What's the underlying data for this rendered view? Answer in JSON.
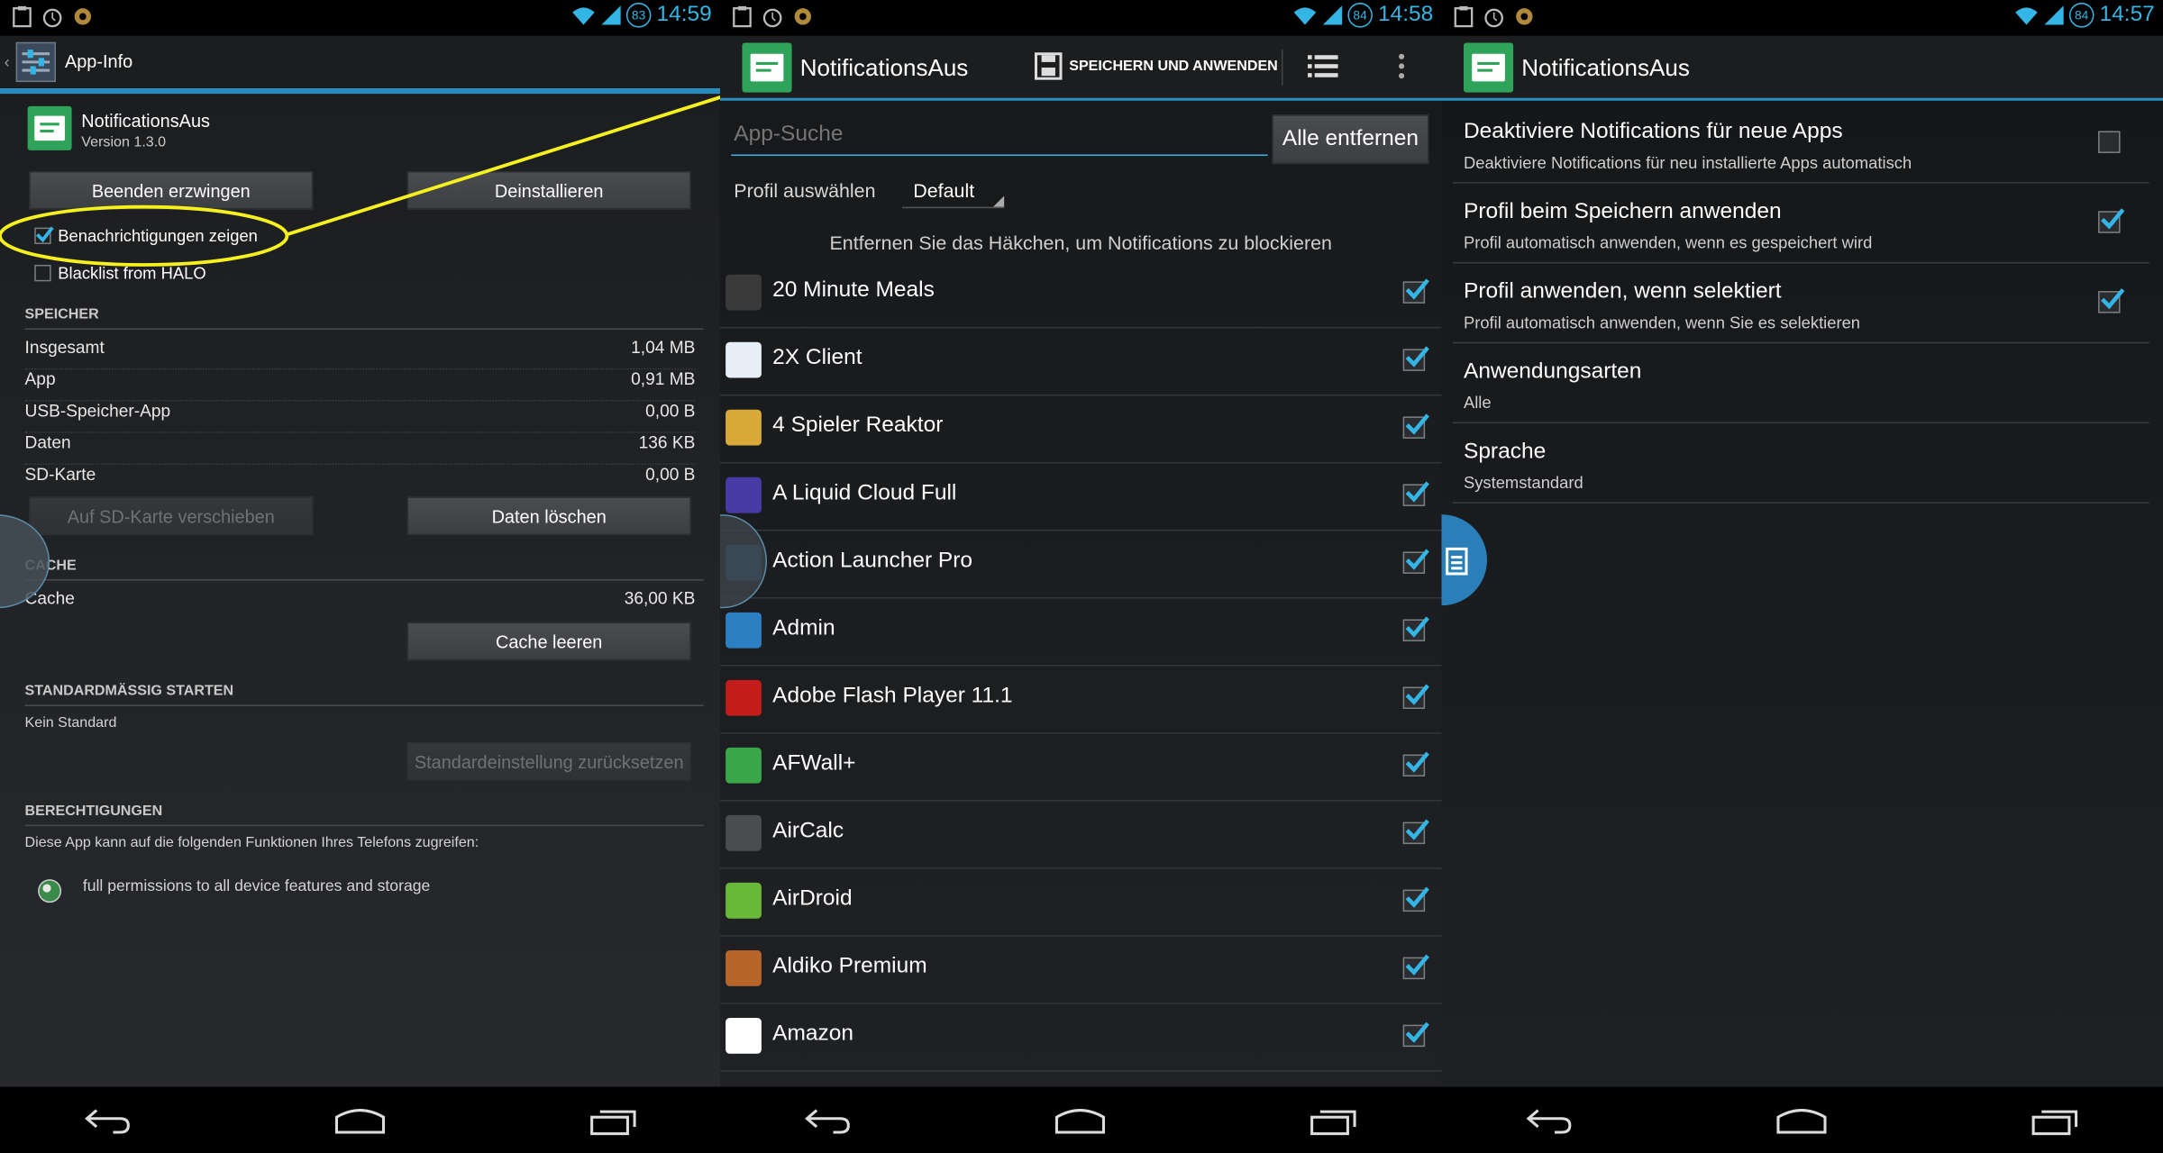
{
  "status": {
    "p1_time": "14:59",
    "p1_battery": "83",
    "p2_time": "14:58",
    "p2_battery": "84",
    "p3_time": "14:57",
    "p3_battery": "84"
  },
  "appinfo": {
    "title": "App-Info",
    "app_name": "NotificationsAus",
    "version": "Version 1.3.0",
    "force_stop": "Beenden erzwingen",
    "uninstall": "Deinstallieren",
    "show_notifications": "Benachrichtigungen zeigen",
    "blacklist": "Blacklist from HALO",
    "storage_header": "SPEICHER",
    "storage": [
      {
        "label": "Insgesamt",
        "value": "1,04 MB"
      },
      {
        "label": "App",
        "value": "0,91 MB"
      },
      {
        "label": "USB-Speicher-App",
        "value": "0,00 B"
      },
      {
        "label": "Daten",
        "value": "136 KB"
      },
      {
        "label": "SD-Karte",
        "value": "0,00 B"
      }
    ],
    "move_sd": "Auf SD-Karte verschieben",
    "clear_data": "Daten löschen",
    "cache_header": "CACHE",
    "cache_label": "Cache",
    "cache_value": "36,00 KB",
    "clear_cache": "Cache leeren",
    "launch_header": "STANDARDMÄSSIG STARTEN",
    "no_default": "Kein Standard",
    "reset_default": "Standardeinstellung zurücksetzen",
    "perm_header": "BERECHTIGUNGEN",
    "perm_desc": "Diese App kann auf die folgenden Funktionen Ihres Telefons zugreifen:",
    "perm_item": "full permissions to all device features and storage"
  },
  "list": {
    "title": "NotificationsAus",
    "save_apply": "SPEICHERN UND ANWENDEN",
    "search_placeholder": "App-Suche",
    "remove_all": "Alle entfernen",
    "profile_label": "Profil auswählen",
    "profile_value": "Default",
    "hint": "Entfernen Sie das Häkchen, um Notifications zu blockieren",
    "apps": [
      {
        "name": "20 Minute Meals",
        "icon": "jamie-oliver-icon",
        "color": "#3a3a3a",
        "checked": true
      },
      {
        "name": "2X Client",
        "icon": "2x-client-icon",
        "color": "#e8eef5",
        "checked": true
      },
      {
        "name": "4 Spieler Reaktor",
        "icon": "reaktor-icon",
        "color": "#d9a93a",
        "checked": true
      },
      {
        "name": "A Liquid Cloud Full",
        "icon": "liquid-cloud-icon",
        "color": "#4a3aa6",
        "checked": true
      },
      {
        "name": "Action Launcher Pro",
        "icon": "action-launcher-icon",
        "color": "#2c6f9a",
        "checked": true
      },
      {
        "name": "Admin",
        "icon": "admin-wrench-icon",
        "color": "#2d7fc4",
        "checked": true
      },
      {
        "name": "Adobe Flash Player 11.1",
        "icon": "flash-icon",
        "color": "#c41b1b",
        "checked": true
      },
      {
        "name": "AFWall+",
        "icon": "afwall-shield-icon",
        "color": "#3aa64a",
        "checked": true
      },
      {
        "name": "AirCalc",
        "icon": "aircalc-icon",
        "color": "#4a4c50",
        "checked": true
      },
      {
        "name": "AirDroid",
        "icon": "airdroid-icon",
        "color": "#6ab83a",
        "checked": true
      },
      {
        "name": "Aldiko Premium",
        "icon": "aldiko-books-icon",
        "color": "#b8652a",
        "checked": true
      },
      {
        "name": "Amazon",
        "icon": "amazon-cart-icon",
        "color": "#ffffff",
        "checked": true
      }
    ]
  },
  "settings": {
    "title": "NotificationsAus",
    "items": [
      {
        "title": "Deaktiviere Notifications für neue Apps",
        "sub": "Deaktiviere Notifications für neu installierte Apps automatisch",
        "checkbox": true,
        "checked": false
      },
      {
        "title": "Profil beim Speichern anwenden",
        "sub": "Profil automatisch anwenden, wenn es gespeichert wird",
        "checkbox": true,
        "checked": true
      },
      {
        "title": "Profil anwenden, wenn selektiert",
        "sub": "Profil automatisch anwenden, wenn Sie es selektieren",
        "checkbox": true,
        "checked": true
      },
      {
        "title": "Anwendungsarten",
        "sub": "Alle",
        "checkbox": false
      },
      {
        "title": "Sprache",
        "sub": "Systemstandard",
        "checkbox": false
      }
    ]
  },
  "colors": {
    "accent": "#33b5e5",
    "highlight": "#f5f01e",
    "app_green": "#2ea359"
  }
}
